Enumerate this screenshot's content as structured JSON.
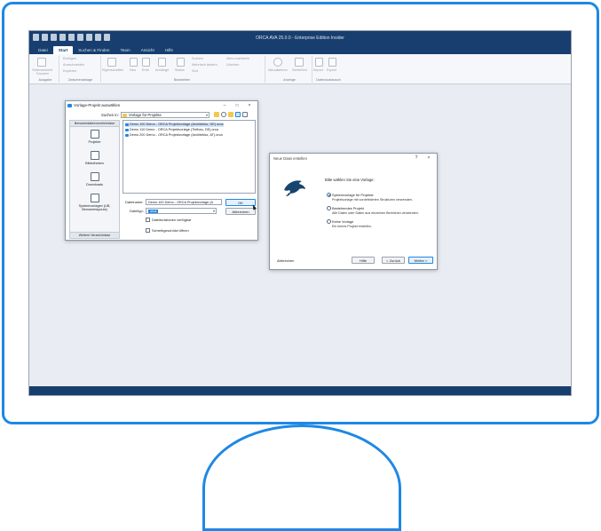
{
  "app": {
    "title": "ORCA AVA 25.0.0 - Enterprise Edition Insider"
  },
  "menubar": {
    "tabs": [
      {
        "label": "Datei",
        "active": false
      },
      {
        "label": "Start",
        "active": true
      },
      {
        "label": "Suchen & Finden",
        "active": false
      },
      {
        "label": "Team",
        "active": false
      },
      {
        "label": "Ansicht",
        "active": false
      },
      {
        "label": "Hilfe",
        "active": false
      }
    ]
  },
  "ribbon": {
    "items": {
      "print_preview": "Seitenansicht",
      "print": "Drucken",
      "insert": "Einfügen",
      "cut": "Ausschneiden",
      "copy": "Kopieren",
      "properties": "Eigenschaften",
      "new": "Neu",
      "delete": "Erhe",
      "pages": "Anhänge",
      "status": "Status",
      "search": "Suchen",
      "replace": "Mehrfach ändern",
      "select_all": "Alles markieren",
      "clear": "Löschen",
      "sort": "Sort",
      "update": "Aktualisieren",
      "refresh": "Schließen",
      "import": "Import",
      "export": "Export"
    },
    "groups": {
      "output": "Ausgabe",
      "clipboard": "Zwischenablage",
      "edit": "Bearbeiten",
      "views": "Anzeige",
      "exchange": "Datenaustausch"
    }
  },
  "dialog_template": {
    "title": "Vorlage-Projekt auswählen",
    "look_in_label": "Suchen in:",
    "look_in_value": "Vorlage für Projekte",
    "places_header": "Benutzerdatenverzeichnisse",
    "places_footer": "Weitere Verzeichnisse",
    "places": [
      {
        "label": "Projekte"
      },
      {
        "label": "Bibliotheken"
      },
      {
        "label": "Downloads"
      },
      {
        "label": "Systemvorlagen (UB, Benutzerlayouts)"
      }
    ],
    "files": [
      {
        "name": "Demo 100 Demo - ORCA Projektvorlage (Architektur, DE).orca",
        "selected": true
      },
      {
        "name": "Demo 110 Demo - ORCA Projektvorlage (Tiefbau, DE).orca",
        "selected": false
      },
      {
        "name": "Demo 200 Demo - ORCA Projektvorlage (Architektur, AT).orca",
        "selected": false
      }
    ],
    "filename_label": "Dateiname:",
    "filename_value": "Demo 100 Demo - ORCA Projektvorlage (A",
    "filetype_label": "Dateityp:",
    "filetype_value": "orca",
    "ok_label": "OK",
    "cancel_label": "Abbrechen",
    "checkbox_search": "Dateifunktionen verfügbar",
    "checkbox_readonly": "Schreibgeschützt öffnen"
  },
  "dialog_new_file": {
    "title": "Neue Datei erstellen",
    "help_char": "?",
    "close_char": "×",
    "prompt": "Bitte wählen Sie eine Vorlage:",
    "options": [
      {
        "label": "Systemvorlage für Projekte",
        "desc": "Projektvorlage mit vordefinierten Strukturen verwenden.",
        "selected": true
      },
      {
        "label": "Bestehendes Projekt",
        "desc": "Alle Daten oder Daten aus einzelnen Bereichen verwenden.",
        "selected": false
      },
      {
        "label": "Keine Vorlage",
        "desc": "Ein leeres Projekt erstellen.",
        "selected": false
      }
    ],
    "cancel_label": "Abbrechen",
    "help_label": "Hilfe",
    "back_label": "< Zurück",
    "next_label": "Weiter >"
  },
  "colors": {
    "accent": "#1e88e5",
    "titlebar": "#173e6e"
  }
}
